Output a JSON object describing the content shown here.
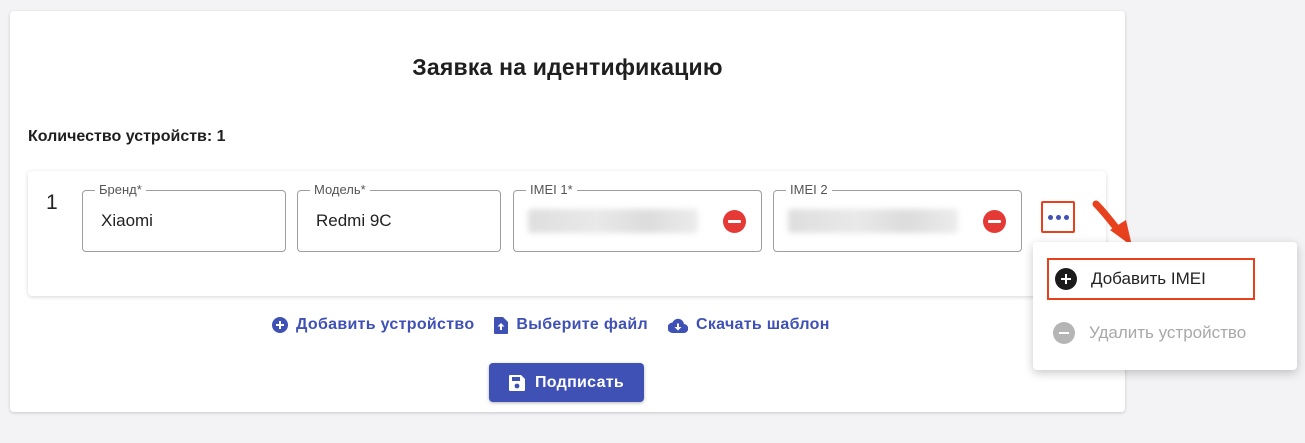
{
  "form": {
    "title": "Заявка на идентификацию",
    "device_count_label": "Количество устройств: 1"
  },
  "device": {
    "number": "1",
    "brand_label": "Бренд*",
    "brand_value": "Xiaomi",
    "model_label": "Модель*",
    "model_value": "Redmi 9C",
    "imei1_label": "IMEI 1*",
    "imei2_label": "IMEI 2"
  },
  "actions": {
    "add_device": "Добавить устройство",
    "choose_file": "Выберите файл",
    "download_template": "Скачать шаблон",
    "sign": "Подписать"
  },
  "menu": {
    "add_imei": "Добавить IMEI",
    "delete_device": "Удалить устройство"
  },
  "colors": {
    "accent": "#3f51b5",
    "danger": "#e53935",
    "highlight": "#e8411e"
  }
}
